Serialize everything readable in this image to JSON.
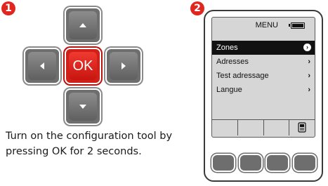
{
  "steps": {
    "step1_number": "1",
    "step2_number": "2"
  },
  "dpad": {
    "ok_label": "OK",
    "up_icon": "triangle-up",
    "down_icon": "triangle-down",
    "left_icon": "triangle-left",
    "right_icon": "triangle-right"
  },
  "instruction": {
    "text": "Turn on the configuration tool by pressing OK for 2 seconds."
  },
  "device": {
    "menu_title": "MENU",
    "battery_icon": "battery-full",
    "items": [
      {
        "label": "Zones",
        "selected": true
      },
      {
        "label": "Adresses",
        "selected": false
      },
      {
        "label": "Test adressage",
        "selected": false
      },
      {
        "label": "Langue",
        "selected": false
      }
    ],
    "softkey_icon": "device-icon"
  },
  "colors": {
    "accent_red": "#e0261f",
    "key_grey": "#6e6e6e",
    "screen_bg": "#d6d6d6"
  }
}
